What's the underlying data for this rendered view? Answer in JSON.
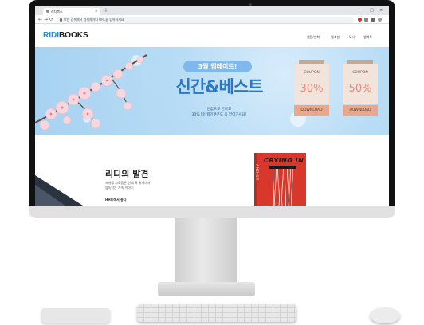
{
  "browser": {
    "tab_title": "리디북스",
    "tab_close": "×",
    "new_tab": "+",
    "url_placeholder": "보안 검색에서 검색하거나 URL을 입력하세요",
    "back": "←",
    "forward": "→",
    "reload": "⟳",
    "minimize": "−",
    "maximize": "□",
    "close": "×"
  },
  "site": {
    "logo_part1": "RIDI",
    "logo_part2": "BOOKS",
    "nav": [
      "웹툰/만화",
      "웹소설",
      "도서",
      "셀렉트"
    ]
  },
  "banner": {
    "badge": "3월 업데이트!",
    "headline": "신간&베스트",
    "sub_line1": "반값으로 만나고",
    "sub_line2": "30% 더! 할인쿠폰도 꼭 받아가세요!",
    "coupons": [
      {
        "label": "COUPON",
        "value": "30%",
        "button": "DOWNLOAD"
      },
      {
        "label": "COUPON",
        "value": "50%",
        "button": "DOWNLOAD"
      }
    ]
  },
  "discovery": {
    "title": "리디의 발견",
    "text_line1": "세계를 사로잡은 신예 톡 위저마저",
    "text_line2": "탐독되는 가족 이야기",
    "link": "HH트에서 좋다",
    "book_title": "CRYING IN",
    "book_spine": "A MEMOIR"
  },
  "colors": {
    "brand_blue": "#1f8ce6",
    "banner_sky": "#a6d2f1",
    "coupon_peach": "#e6a88e",
    "book_red": "#d8382c"
  }
}
